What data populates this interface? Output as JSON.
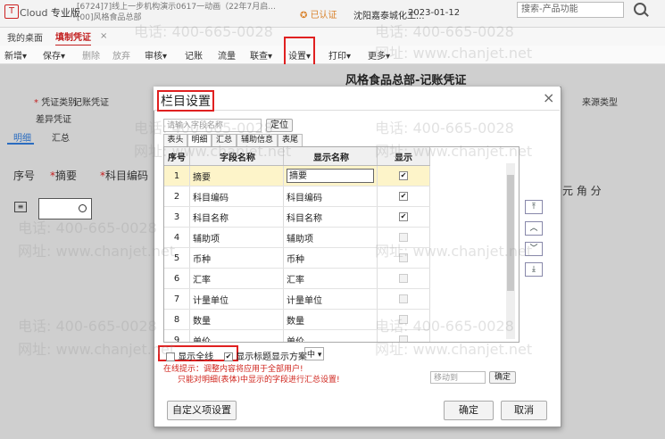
{
  "app": {
    "brand": "Cloud",
    "edition": "专业版",
    "account_line1": "[6724]7]线上一步机构演示0617一动画（22年7月启...",
    "account_line2": "[00]风格食品总部",
    "verified": "已认证",
    "company": "沈阳嘉泰城化工...",
    "date": "2023-01-12",
    "search_placeholder": "搜索-产品功能"
  },
  "tabs": [
    {
      "label": "我的桌面",
      "active": false
    },
    {
      "label": "填制凭证",
      "active": true
    }
  ],
  "tab_close": "×",
  "toolbar": [
    "新增▾",
    "保存▾",
    "删除",
    "放弃",
    "审核▾",
    "记账",
    "流量",
    "联查▾",
    "设置▾",
    "打印▾",
    "更多▾"
  ],
  "toolbar_disabled": [
    "删除",
    "放弃"
  ],
  "page": {
    "title": "风格食品总部-记账凭证",
    "voucher_type_label": "凭证类别",
    "voucher_type_value": "记账凭证",
    "diff_label": "差异凭证",
    "source_label": "来源类型",
    "subtabs": [
      "明细",
      "汇总"
    ],
    "grid_headers": [
      "序号",
      "摘要",
      "科目编码"
    ],
    "amount_header": "元 角 分"
  },
  "dialog": {
    "title": "栏目设置",
    "field_search_placeholder": "请输入字段名称",
    "locate_button": "定位",
    "section_tabs": [
      "表头",
      "明细",
      "汇总",
      "辅助信息",
      "表尾"
    ],
    "active_section": "明细",
    "columns": [
      "序号",
      "字段名称",
      "显示名称",
      "显示"
    ],
    "rows": [
      {
        "no": "1",
        "field": "摘要",
        "display": "摘要",
        "checked": true,
        "selected": true
      },
      {
        "no": "2",
        "field": "科目编码",
        "display": "科目编码",
        "checked": true
      },
      {
        "no": "3",
        "field": "科目名称",
        "display": "科目名称",
        "checked": true
      },
      {
        "no": "4",
        "field": "辅助项",
        "display": "辅助项",
        "checked": false
      },
      {
        "no": "5",
        "field": "币种",
        "display": "币种",
        "checked": false
      },
      {
        "no": "6",
        "field": "汇率",
        "display": "汇率",
        "checked": false
      },
      {
        "no": "7",
        "field": "计量单位",
        "display": "计量单位",
        "checked": false
      },
      {
        "no": "8",
        "field": "数量",
        "display": "数量",
        "checked": false
      },
      {
        "no": "9",
        "field": "单价",
        "display": "单价",
        "checked": false
      }
    ],
    "move_buttons": [
      "⌃",
      "^",
      "v",
      "⌄"
    ],
    "option_show_all_lines": "显示全线",
    "option_show_title": "显示标题",
    "display_scheme_label": "显示方案",
    "display_scheme_value": "中",
    "tip_line1": "在线提示：调整内容将应用于全部用户!",
    "tip_line2": "只能对明细(表体)中显示的字段进行汇总设置!",
    "move_to_placeholder": "移动到",
    "confirm_small": "确定",
    "custom_button": "自定义项设置",
    "ok_button": "确定",
    "cancel_button": "取消"
  },
  "watermark": {
    "phone": "电话: 400-665-0028",
    "site": "网址: www.chanjet.net"
  },
  "colors": {
    "accent": "#c21f1f",
    "highlight_box": "#e02020",
    "selected_row": "#fdf4c9"
  }
}
